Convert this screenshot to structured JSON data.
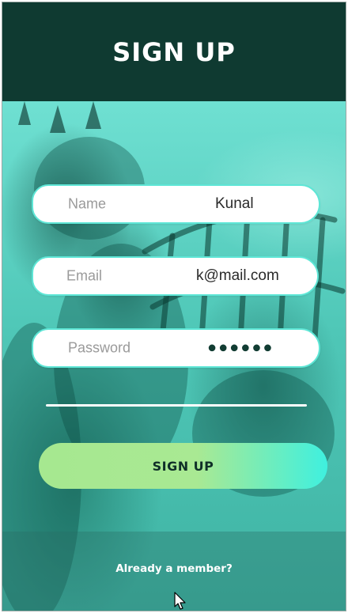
{
  "header": {
    "title": "SIGN UP"
  },
  "form": {
    "name": {
      "placeholder": "Name",
      "value": "Kunal"
    },
    "email": {
      "placeholder": "Email",
      "value": "k@mail.com"
    },
    "password": {
      "placeholder": "Password",
      "value": "●●●●●●"
    }
  },
  "actions": {
    "signup_label": "SIGN UP",
    "member_link": "Already a member?"
  },
  "colors": {
    "header_bg": "#0f3a31",
    "accent_teal": "#5ee6d6",
    "button_gradient_start": "#a6e890",
    "button_gradient_end": "#3ff0df"
  }
}
